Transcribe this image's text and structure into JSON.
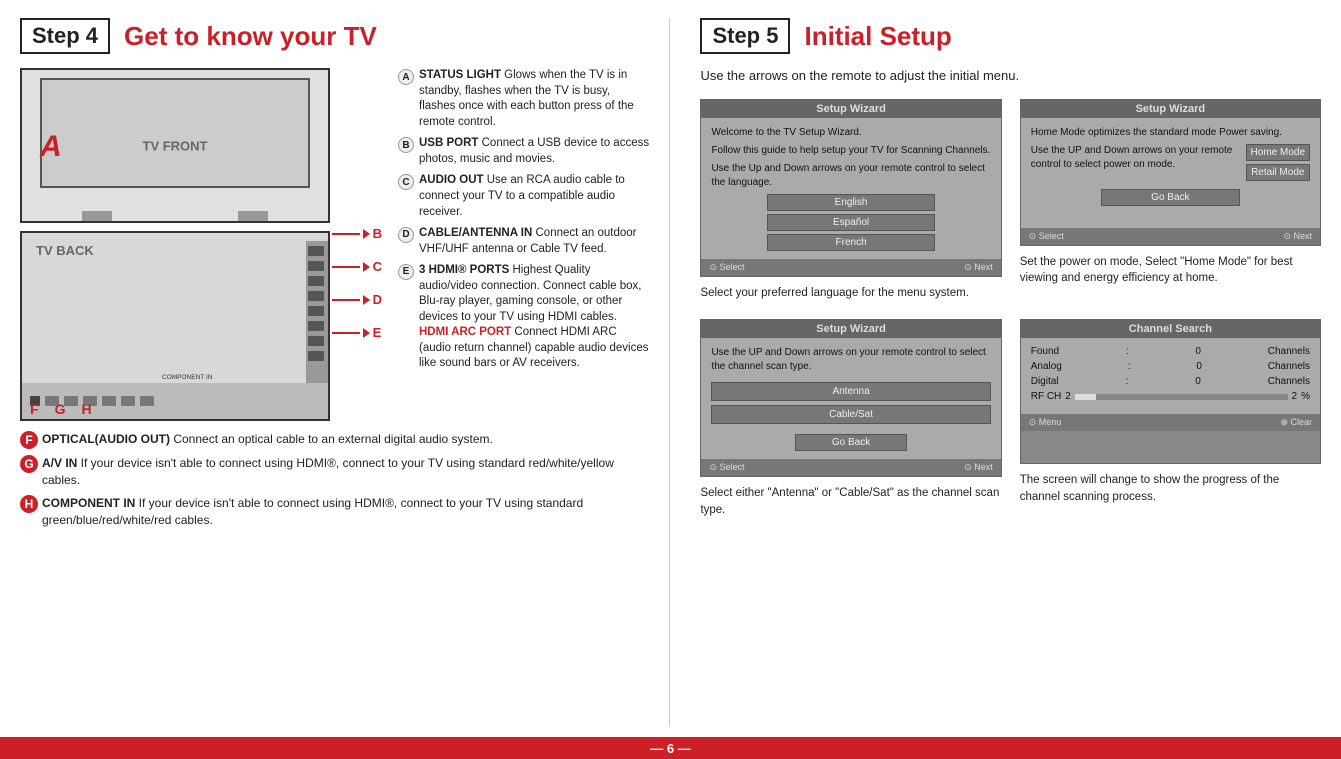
{
  "step4": {
    "box_label": "Step 4",
    "title": "Get to know your TV",
    "tv_front_label": "TV FRONT",
    "tv_back_label": "TV BACK",
    "marker_a": "A",
    "arrow_b": "B",
    "arrow_c": "C",
    "arrow_d": "D",
    "arrow_e": "E",
    "descriptions": [
      {
        "letter": "A",
        "title": "STATUS LIGHT",
        "text": " Glows when the TV is in standby, flashes when the TV is busy, flashes once with each button press of the remote control."
      },
      {
        "letter": "B",
        "title": "USB PORT",
        "text": " Connect a USB device to access photos, music and movies."
      },
      {
        "letter": "C",
        "title": "AUDIO OUT",
        "text": " Use an RCA audio cable to connect your TV to a compatible audio receiver."
      },
      {
        "letter": "D",
        "title": "CABLE/ANTENNA IN",
        "text": " Connect an outdoor VHF/UHF antenna or Cable TV feed."
      },
      {
        "letter": "E",
        "title": "3 HDMI® PORTS",
        "text": " Highest Quality audio/video connection. Connect cable box, Blu-ray player, gaming console, or other devices to your TV using HDMI cables.",
        "subtitle": "HDMI ARC PORT",
        "subtitle_text": " Connect HDMI ARC (audio return channel) capable audio devices like sound bars or AV receivers."
      }
    ],
    "bottom_items": [
      {
        "letter": "F",
        "title": "OPTICAL(AUDIO OUT)",
        "text": " Connect an optical cable to an external digital audio system."
      },
      {
        "letter": "G",
        "title": "A/V IN",
        "text": " If your device isn't able to connect using HDMI®, connect to your TV using standard red/white/yellow cables."
      },
      {
        "letter": "H",
        "title": "COMPONENT IN",
        "text": " If your device isn't able to connect using HDMI®, connect to your TV using standard green/blue/red/white/red cables."
      }
    ],
    "component_in_label": "COMPONENT IN"
  },
  "step5": {
    "box_label": "Step 5",
    "title": "Initial Setup",
    "intro": "Use the arrows on the remote to adjust the initial menu.",
    "wizard1": {
      "title": "Setup Wizard",
      "body_line1": "Welcome to the TV Setup Wizard.",
      "body_line2": "Follow this guide to help setup your TV for Scanning Channels.",
      "body_line3": "Use the Up and Down arrows on your remote control to select the language.",
      "options": [
        "English",
        "Español",
        "French"
      ],
      "footer_left": "⊙ Select",
      "footer_right": "⊙ Next",
      "caption": "Select your preferred language for the menu system."
    },
    "wizard2": {
      "title": "Setup Wizard",
      "body_line1": "Home Mode optimizes the standard mode Power saving.",
      "body_line2": "Use the UP and Down arrows on your remote control  to select power on mode.",
      "options": [
        "Home Mode",
        "Retail Mode"
      ],
      "go_back": "Go Back",
      "footer_left": "⊙ Select",
      "footer_right": "⊙ Next",
      "caption": "Set the power on mode, Select \"Home Mode\" for best viewing and energy efficiency at home."
    },
    "wizard3": {
      "title": "Setup Wizard",
      "body_line1": "Use the UP and Down arrows on your remote control  to select the channel scan type.",
      "options": [
        "Antenna",
        "Cable/Sat"
      ],
      "go_back": "Go Back",
      "footer_left": "⊙ Select",
      "footer_right": "⊙ Next",
      "caption": "Select either \"Antenna\" or \"Cable/Sat\" as the channel scan type."
    },
    "wizard4": {
      "title": "Channel Search",
      "found_label": "Found",
      "found_colon": ":",
      "found_value": "0",
      "found_channels": "Channels",
      "analog_label": "Analog",
      "analog_colon": ":",
      "analog_value": "0",
      "analog_channels": "Channels",
      "digital_label": "Digital",
      "digital_colon": ":",
      "digital_value": "0",
      "digital_channels": "Channels",
      "rf_label": "RF CH",
      "rf_value_left": "2",
      "rf_value_right": "2",
      "rf_percent": "%",
      "footer_left": "⊙ Menu",
      "footer_right": "⊗ Clear",
      "caption": "The screen will change to show the progress of the channel scanning process."
    }
  },
  "footer": {
    "page_number": "— 6 —"
  }
}
